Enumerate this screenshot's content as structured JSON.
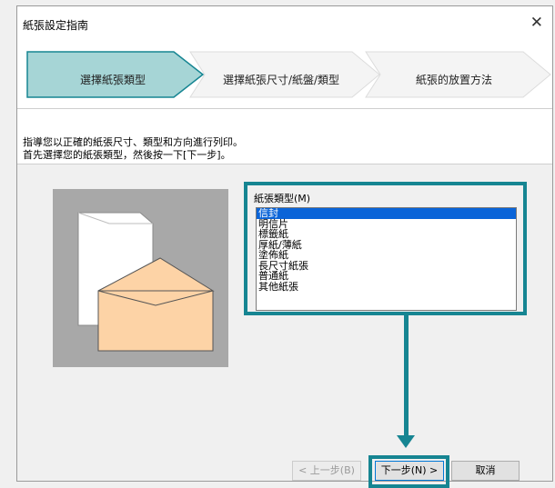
{
  "window": {
    "title": "紙張設定指南",
    "close_glyph": "✕"
  },
  "steps": [
    {
      "label": "選擇紙張類型",
      "active": true
    },
    {
      "label": "選擇紙張尺寸/紙盤/類型",
      "active": false
    },
    {
      "label": "紙張的放置方法",
      "active": false
    }
  ],
  "instructions": {
    "line1": "指導您以正確的紙張尺寸、類型和方向進行列印。",
    "line2": "首先選擇您的紙張類型，然後按一下[下一步]。"
  },
  "paper_type": {
    "label": "紙張類型(M)",
    "items": [
      "信封",
      "明信片",
      "標籤紙",
      "厚紙/薄紙",
      "塗佈紙",
      "長尺寸紙張",
      "普通紙",
      "其他紙張"
    ],
    "selected": "信封"
  },
  "buttons": {
    "back": "< 上一步(B)",
    "next": "下一步(N) >",
    "cancel": "取消"
  },
  "colors": {
    "highlight": "#168592",
    "active_step": "#a6d5d6",
    "inactive_step": "#f4f4f4",
    "envelope_body": "#fdd3a6",
    "selection": "#0a64d8"
  },
  "icons": {
    "close": "close-icon",
    "illustration": "envelope-illustration",
    "guide_arrow": "down-arrow-icon"
  }
}
